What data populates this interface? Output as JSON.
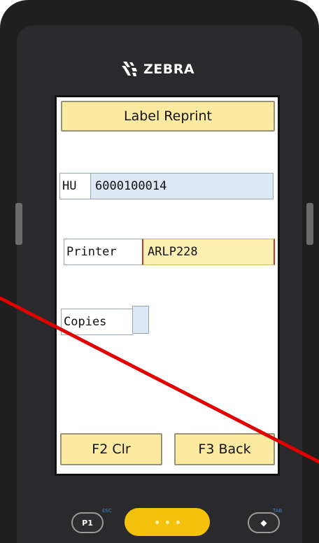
{
  "device": {
    "brand": "ZEBRA",
    "keys": {
      "p1": "P1",
      "diamond": "◆",
      "esc_tag": "ESC",
      "tab_tag": "TAB"
    }
  },
  "screen": {
    "title_button": "Label Reprint",
    "fields": {
      "hu": {
        "label": "HU",
        "value": "6000100014"
      },
      "printer": {
        "label": "Printer",
        "value": "ARLP228"
      },
      "copies": {
        "label": "Copies",
        "value": ""
      }
    },
    "buttons": {
      "clear": "F2 Clr",
      "back": "F3 Back"
    }
  },
  "colors": {
    "button_fill": "#fbeaa0",
    "field_fill": "#dde8f5",
    "active_field_fill": "#fdf0b2",
    "scan_key": "#f4c20d",
    "annotation_line": "#e00000"
  }
}
